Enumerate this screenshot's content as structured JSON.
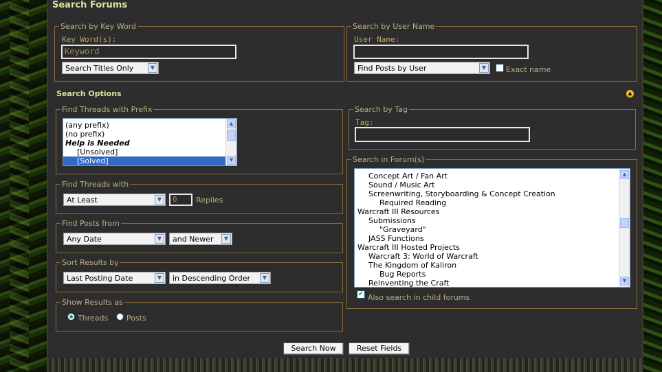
{
  "page": {
    "title": "Search Forums"
  },
  "keyword_section": {
    "legend": "Search by Key Word",
    "label": "Key Word(s):",
    "input_value": "Keyword",
    "scope_select": "Search Titles Only"
  },
  "user_section": {
    "legend": "Search by User Name",
    "label": "User Name:",
    "input_value": "",
    "mode_select": "Find Posts by User",
    "exact_label": "Exact name"
  },
  "options_header": "Search Options",
  "prefix_section": {
    "legend": "Find Threads with Prefix",
    "items": [
      {
        "label": "(any prefix)"
      },
      {
        "label": "(no prefix)"
      },
      {
        "label": "Help is Needed"
      },
      {
        "label": "[Unsolved]"
      },
      {
        "label": "[Solved]"
      }
    ]
  },
  "replies_section": {
    "legend": "Find Threads with",
    "select": "At Least",
    "value": "0",
    "unit": "Replies"
  },
  "posts_from_section": {
    "legend": "Find Posts from",
    "date_select": "Any Date",
    "direction_select": "and Newer"
  },
  "sort_section": {
    "legend": "Sort Results by",
    "field_select": "Last Posting Date",
    "order_select": "in Descending Order"
  },
  "show_section": {
    "legend": "Show Results as",
    "threads_label": "Threads",
    "posts_label": "Posts",
    "selected": "Threads"
  },
  "tag_section": {
    "legend": "Search by Tag",
    "label": "Tag:",
    "input_value": ""
  },
  "forums_section": {
    "legend": "Search in Forum(s)",
    "items": [
      {
        "label": "Concept Art / Fan Art"
      },
      {
        "label": "Sound / Music Art"
      },
      {
        "label": "Screenwriting, Storyboarding & Concept Creation"
      },
      {
        "label": "Required Reading"
      },
      {
        "label": "Warcraft III Resources"
      },
      {
        "label": "Submissions"
      },
      {
        "label": "\"Graveyard\""
      },
      {
        "label": "JASS Functions"
      },
      {
        "label": "Warcraft III Hosted Projects"
      },
      {
        "label": "Warcraft 3: World of Warcraft"
      },
      {
        "label": "The Kingdom of Kaliron"
      },
      {
        "label": "Bug Reports"
      },
      {
        "label": "Reinventing the Craft"
      }
    ],
    "child_label": "Also search in child forums",
    "child_checked": true
  },
  "buttons": {
    "search": "Search Now",
    "reset": "Reset Fields"
  },
  "icons": {
    "collapse": "collapse-up-icon",
    "dropdown": "chevron-down-icon"
  },
  "colors": {
    "title": "#cfe89a",
    "panel": "#2d2d2d",
    "border": "#8a6a3c",
    "selection": "#316ac5"
  }
}
